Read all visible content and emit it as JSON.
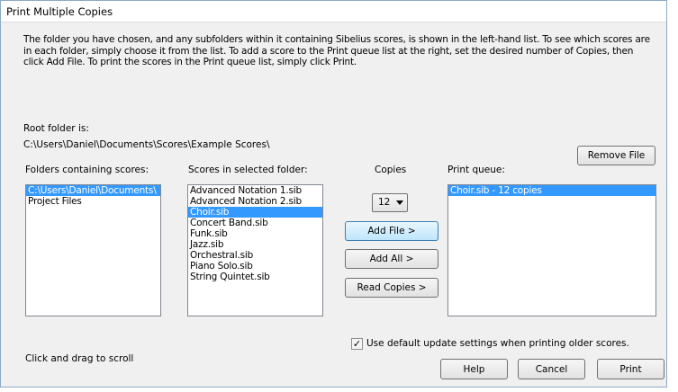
{
  "window": {
    "title": "Print Multiple Copies"
  },
  "intro_text": "The folder you have chosen, and any subfolders within it containing Sibelius scores, is shown in the left-hand list.  To see which scores are in each folder, simply choose it from the list.  To add a score to the Print queue list at the right, set the desired number of Copies, then click Add File.  To print the scores in the Print queue list, simply click Print.",
  "root": {
    "label": "Root folder is:",
    "path": "C:\\Users\\Daniel\\Documents\\Scores\\Example Scores\\"
  },
  "labels": {
    "folders": "Folders containing scores:",
    "scores": "Scores in selected folder:",
    "copies": "Copies",
    "queue": "Print queue:"
  },
  "folders": [
    "C:\\Users\\Daniel\\Documents\\",
    "Project Files"
  ],
  "scores": [
    "Advanced Notation 1.sib",
    "Advanced Notation 2.sib",
    "Choir.sib",
    "Concert Band.sib",
    "Funk.sib",
    "Jazz.sib",
    "Orchestral.sib",
    "Piano Solo.sib",
    "String Quintet.sib"
  ],
  "copies_value": "12",
  "queue": [
    "Choir.sib - 12 copies"
  ],
  "buttons": {
    "remove_file": "Remove File",
    "add_file": "Add File >",
    "add_all": "Add All >",
    "read_copies": "Read Copies >",
    "help": "Help",
    "cancel": "Cancel",
    "print": "Print"
  },
  "checkbox": {
    "label": "Use default update settings when printing older scores.",
    "checked": true,
    "mark": "✓"
  },
  "status": "Click and drag to scroll"
}
